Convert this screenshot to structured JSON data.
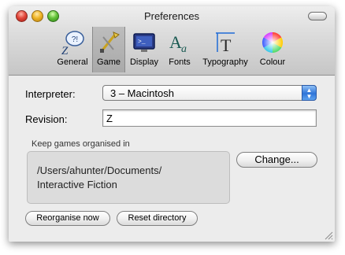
{
  "window": {
    "title": "Preferences"
  },
  "toolbar": {
    "items": [
      {
        "label": "General",
        "icon": "general-icon"
      },
      {
        "label": "Game",
        "icon": "game-icon",
        "selected": true
      },
      {
        "label": "Display",
        "icon": "display-icon"
      },
      {
        "label": "Fonts",
        "icon": "fonts-icon"
      },
      {
        "label": "Typography",
        "icon": "typography-icon"
      },
      {
        "label": "Colour",
        "icon": "colour-icon"
      }
    ]
  },
  "form": {
    "interpreter_label": "Interpreter:",
    "interpreter_value": "3 – Macintosh",
    "revision_label": "Revision:",
    "revision_value": "Z"
  },
  "directory": {
    "caption": "Keep games organised in",
    "path_line1": "/Users/ahunter/Documents/",
    "path_line2": "Interactive Fiction",
    "change_button": "Change...",
    "reorganise_button": "Reorganise now",
    "reset_button": "Reset directory"
  },
  "colors": {
    "accent": "#2f74d8",
    "window_bg": "#ececec"
  }
}
